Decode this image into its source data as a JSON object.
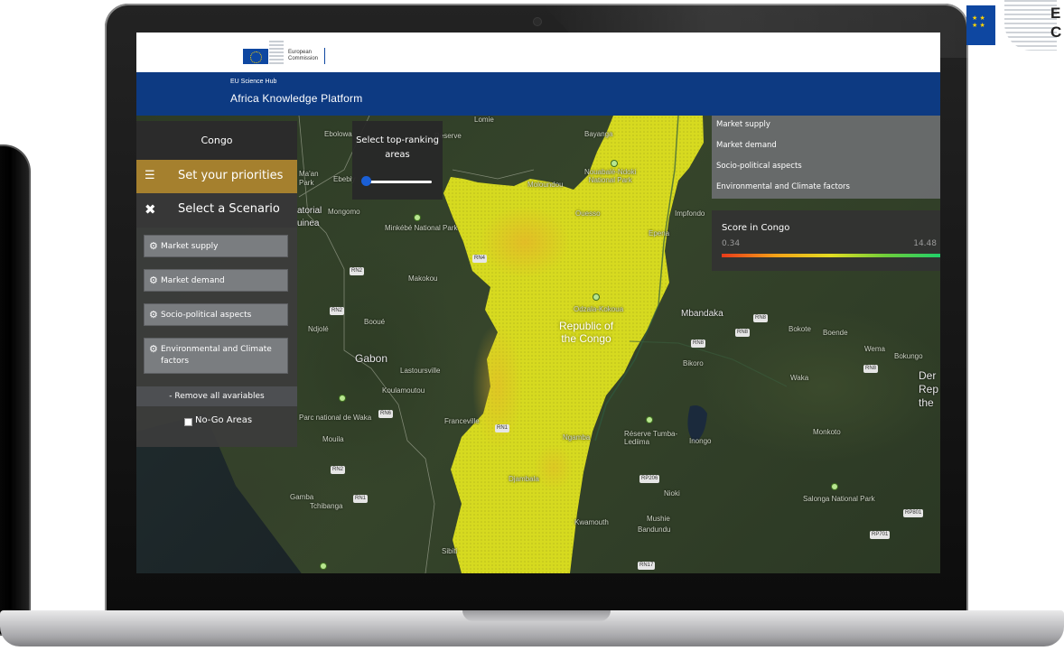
{
  "corner_logo": {
    "letters": "E\nC"
  },
  "header": {
    "logo_text": "European\nCommission",
    "hub_small": "EU Science Hub",
    "hub_title": "Africa Knowledge Platform"
  },
  "panel": {
    "country": "Congo",
    "priorities_label": "Set your priorities",
    "scenario_label": "Select a Scenario",
    "variables": [
      "Market supply",
      "Market demand",
      "Socio-political aspects",
      "Environmental and Climate factors"
    ],
    "remove_label": "- Remove all avariables",
    "nogo_label": "No-Go Areas"
  },
  "ranking": {
    "title": "Select top-ranking areas",
    "slider_value": 0
  },
  "legend": {
    "items": [
      "Market supply",
      "Market demand",
      "Socio-political aspects",
      "Environmental and Climate factors"
    ],
    "score_title": "Score in Congo",
    "score_min": "0.34",
    "score_max": "14.48"
  },
  "map": {
    "labels": {
      "ebolowa": "Ebolowa",
      "bayanga": "Bayanga",
      "lomie": "Lomie",
      "reserve": "Reserve",
      "ebebiy": "Ebebiy",
      "maan": "Ma'an",
      "park": "Park",
      "torial": "atorial",
      "guinea": "uinea",
      "mongomo": "Mongomo",
      "minkebe": "Minkébé National Park",
      "moloundou": "Moloundou",
      "nouabale": "Nouabalé-Ndoki\nNational Park",
      "ouesso": "Ouesso",
      "impfondo": "Impfondo",
      "epena": "Epena",
      "makokou": "Makokou",
      "mbandaka": "Mbandaka",
      "boende": "Boende",
      "bokote": "Bokote",
      "wema": "Wema",
      "bokungo": "Bokungo",
      "booue": "Booué",
      "ndjole": "Ndjolé",
      "gabon": "Gabon",
      "lastoursville": "Lastoursville",
      "koulamoutou": "Koulamoutou",
      "congo_country": "Republic of\nthe Congo",
      "bikoro": "Bikoro",
      "waka": "Waka",
      "monkoto": "Monkoto",
      "dem": "Der\nRep\nthe",
      "waka_park": "Parc national de Waka",
      "franceville": "Franceville",
      "mouila": "Mouila",
      "tumba": "Réserve Tumba-\nLediima",
      "inongo": "Inongo",
      "gamba": "Gamba",
      "tchibanga": "Tchibanga",
      "nioki": "Nioki",
      "mushie": "Mushie",
      "bandundu": "Bandundu",
      "salonga": "Salonga National Park",
      "ngamba": "Ngamba",
      "kwamouth": "Kwamouth",
      "djambala": "Djambala",
      "odzala": "Odzala-Kokoua",
      "sibiti": "Sibiti"
    },
    "roads": [
      "RN2",
      "RN4",
      "RN2",
      "RN1",
      "RN6",
      "RN8",
      "RN8",
      "RN8",
      "RN8",
      "RP206",
      "RN1",
      "RP801",
      "RP701",
      "RN17",
      "RN2"
    ]
  },
  "colors": {
    "eu_blue": "#0d3a82",
    "priorities": "#a5802e",
    "heat_yellow": "#e3e021",
    "slider_thumb": "#1a5fd6"
  }
}
